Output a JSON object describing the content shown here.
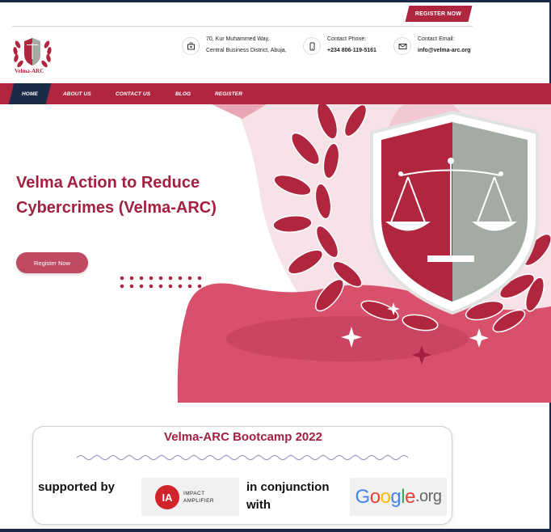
{
  "header": {
    "register_button": "REGISTER NOW",
    "logo_text": "Velma-ARC",
    "address": {
      "line1": "70, Kur Muhammed Way,",
      "line2": "Central Business District, Abuja,"
    },
    "phone": {
      "label": "Contact Phone:",
      "value": "+234 806-119-5161"
    },
    "email": {
      "label": "Contact Email:",
      "value": "info@velma-arc.org"
    }
  },
  "nav": {
    "items": [
      "HOME",
      "ABOUT US",
      "CONTACT US",
      "BLOG",
      "REGISTER"
    ],
    "active": "HOME"
  },
  "hero": {
    "title_line1": "Velma Action to Reduce",
    "title_line2": "Cybercrimes (Velma-ARC)",
    "button": "Register Now"
  },
  "card": {
    "title": "Velma-ARC Bootcamp 2022",
    "supported_by": "supported by",
    "partner1": {
      "line1": "IMPACT",
      "line2": "AMPLIFIER",
      "mark": "IA"
    },
    "conjunction_line1": "in conjunction",
    "conjunction_line2": "with",
    "partner2": {
      "g1": "G",
      "g2": "o",
      "g3": "o",
      "g4": "g",
      "g5": "l",
      "g6": "e",
      "suffix": ".org"
    }
  },
  "colors": {
    "brand": "#b1263f",
    "navy": "#1c2a4a",
    "hero_pink": "#d8506b"
  },
  "icons": {
    "address": "location-icon",
    "phone": "phone-icon",
    "email": "mail-icon"
  }
}
